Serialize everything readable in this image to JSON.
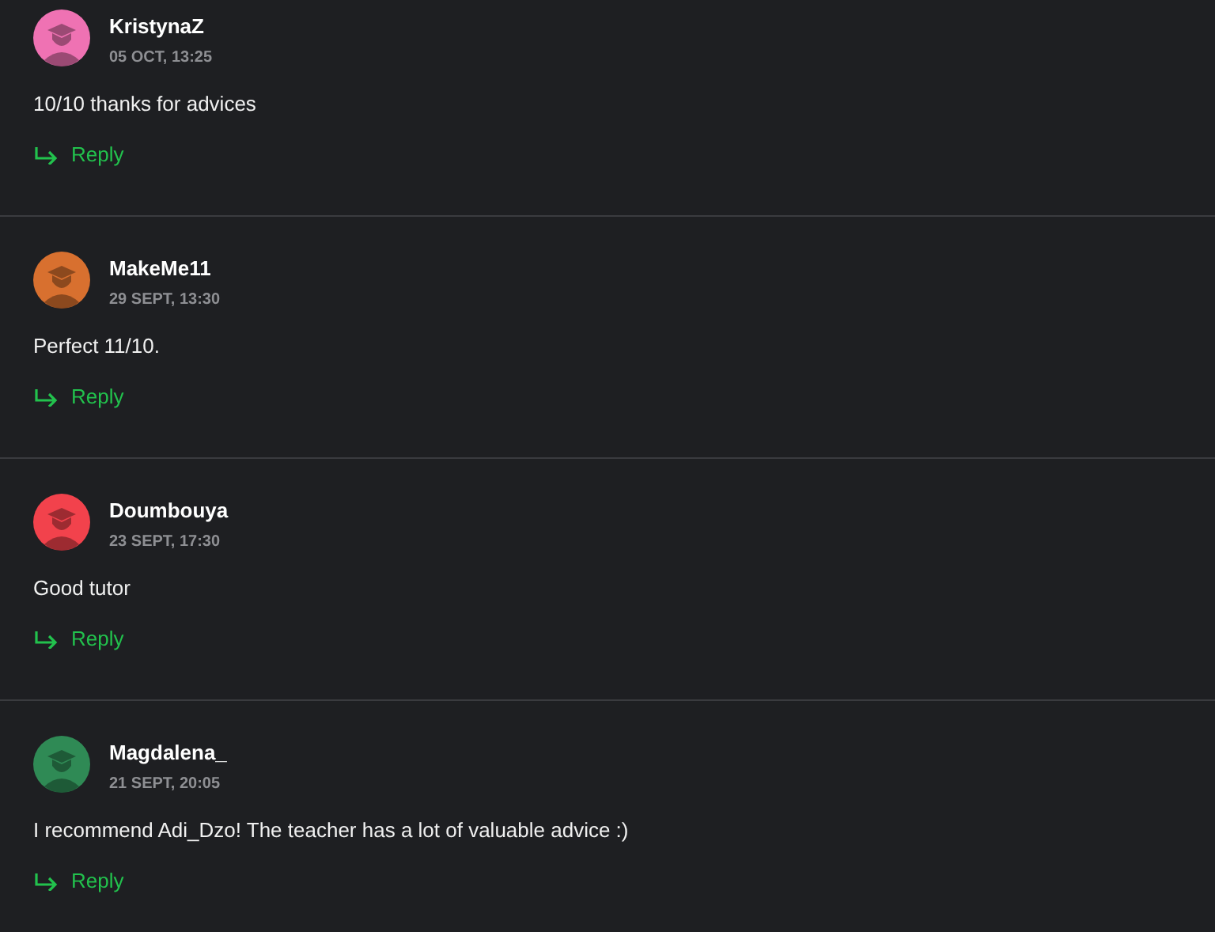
{
  "comments": [
    {
      "author": "KristynaZ",
      "date": "05 OCT, 13:25",
      "text": "10/10 thanks for advices",
      "reply": "Reply",
      "color": "#ef72b3"
    },
    {
      "author": "MakeMe11",
      "date": "29 SEPT, 13:30",
      "text": "Perfect 11/10.",
      "reply": "Reply",
      "color": "#d8702f"
    },
    {
      "author": "Doumbouya",
      "date": "23 SEPT, 17:30",
      "text": "Good tutor",
      "reply": "Reply",
      "color": "#f2424c"
    },
    {
      "author": "Magdalena_",
      "date": "21 SEPT, 20:05",
      "text": "I recommend Adi_Dzo! The teacher has a lot of valuable advice :)",
      "reply": "Reply",
      "color": "#2f8a55"
    }
  ]
}
